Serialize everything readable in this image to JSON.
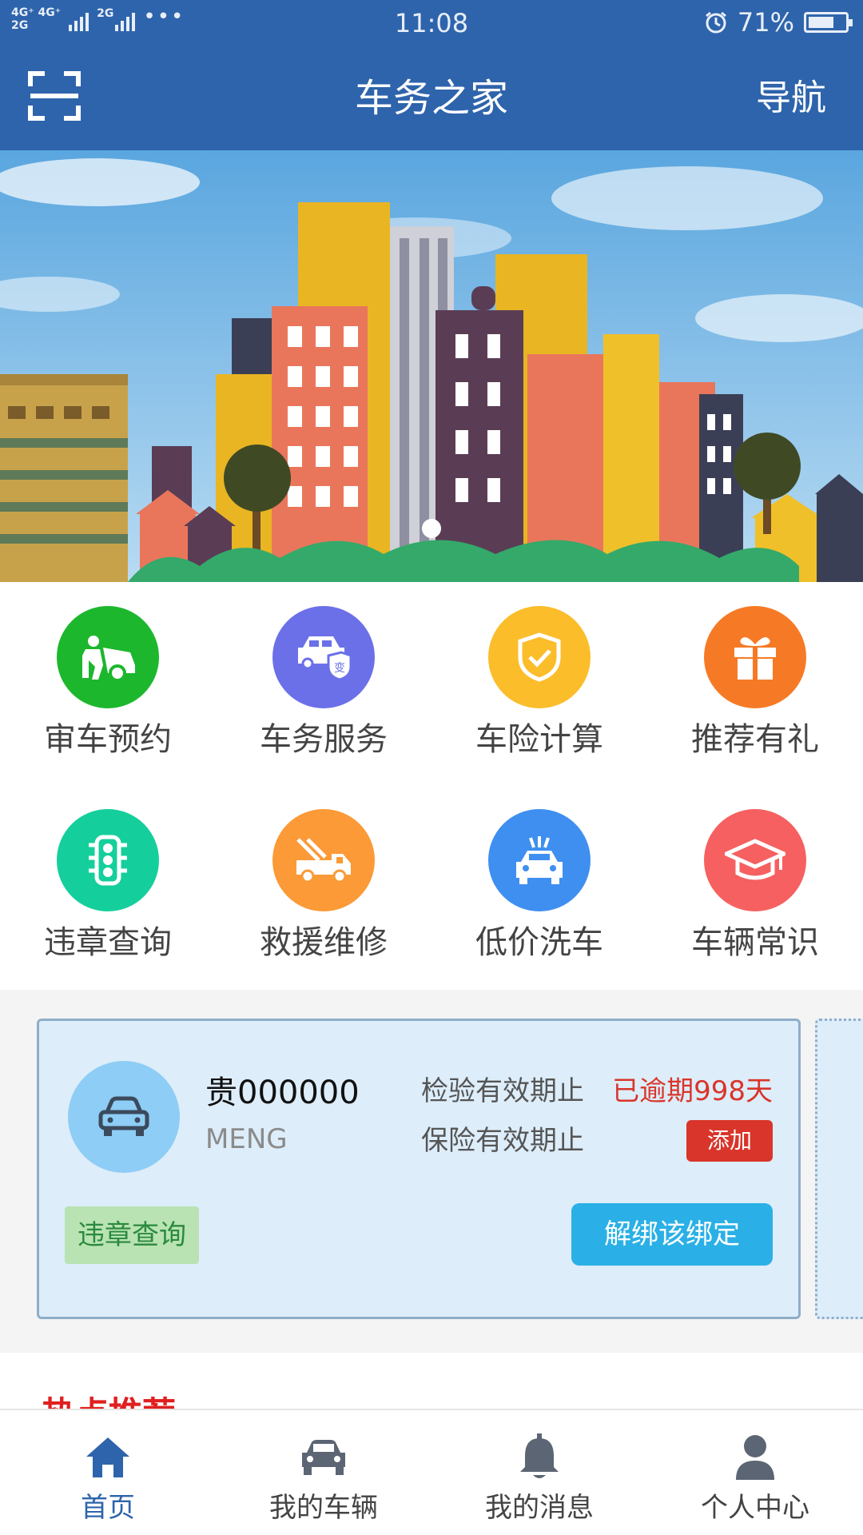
{
  "status_bar": {
    "network_top": "4G⁺ 4G⁺",
    "network_bottom": "2G",
    "network2": "2G",
    "time": "11:08",
    "battery": "71%",
    "battery_level": 0.71
  },
  "header": {
    "title": "车务之家",
    "nav_label": "导航"
  },
  "banner": {
    "active_index": 0,
    "total": 1
  },
  "services": [
    {
      "label": "审车预约",
      "icon": "car-inspection-icon",
      "color": "#1cb72d"
    },
    {
      "label": "车务服务",
      "icon": "car-transfer-icon",
      "color": "#6b70e8"
    },
    {
      "label": "车险计算",
      "icon": "shield-check-icon",
      "color": "#fbbd2a"
    },
    {
      "label": "推荐有礼",
      "icon": "gift-icon",
      "color": "#f67a25"
    },
    {
      "label": "违章查询",
      "icon": "traffic-light-icon",
      "color": "#14cf9c"
    },
    {
      "label": "救援维修",
      "icon": "tow-truck-icon",
      "color": "#fb9a36"
    },
    {
      "label": "低价洗车",
      "icon": "car-wash-icon",
      "color": "#3f8ff0"
    },
    {
      "label": "车辆常识",
      "icon": "graduation-cap-icon",
      "color": "#f66060"
    }
  ],
  "vehicle": {
    "plate": "贵000000",
    "owner": "MENG",
    "inspection_label": "检验有效期止",
    "inspection_value": "已逾期998天",
    "insurance_label": "保险有效期止",
    "add_label": "添加",
    "violation_label": "违章查询",
    "unbind_label": "解绑该绑定"
  },
  "hot": {
    "title": "热点推荐"
  },
  "tabs": [
    {
      "label": "首页",
      "icon": "home-icon",
      "active": true
    },
    {
      "label": "我的车辆",
      "icon": "car-icon",
      "active": false
    },
    {
      "label": "我的消息",
      "icon": "bell-icon",
      "active": false
    },
    {
      "label": "个人中心",
      "icon": "user-icon",
      "active": false
    }
  ],
  "colors": {
    "primary": "#2e64ab",
    "alert_red": "#d9352a",
    "action_blue": "#2ab0e6"
  }
}
